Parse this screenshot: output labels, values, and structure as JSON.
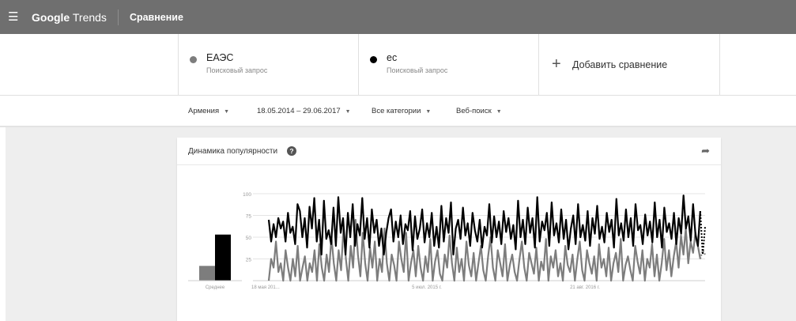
{
  "topbar": {
    "menu_icon": "menu-icon",
    "logo_google": "Google",
    "logo_trends": "Trends",
    "page_name": "Сравнение"
  },
  "terms": [
    {
      "name": "ЕАЭС",
      "type": "Поисковый запрос",
      "color": "#7d7d7d"
    },
    {
      "name": "ес",
      "type": "Поисковый запрос",
      "color": "#000000"
    }
  ],
  "add_compare": {
    "icon": "plus-icon",
    "label": "Добавить сравнение"
  },
  "filters": {
    "region": "Армения",
    "dates": "18.05.2014 – 29.06.2017",
    "category": "Все категории",
    "search_type": "Веб-поиск"
  },
  "card": {
    "title": "Динамика популярности",
    "help_icon": "help-icon",
    "share_icon": "share-icon"
  },
  "chart_data": {
    "type": "line",
    "y_ticks": [
      "100",
      "75",
      "50",
      "25"
    ],
    "ylim": [
      0,
      100
    ],
    "x_tick_labels": [
      "18 мая 201...",
      "5 июл. 2015 г.",
      "21 авг. 2016 г."
    ],
    "average_label": "Среднее",
    "averages": [
      {
        "term": "ЕАЭС",
        "value": 17,
        "color": "#7d7d7d"
      },
      {
        "term": "ес",
        "value": 53,
        "color": "#000000"
      }
    ],
    "series": [
      {
        "name": "ес",
        "color": "#000000",
        "values": [
          70,
          45,
          65,
          50,
          72,
          60,
          68,
          45,
          78,
          55,
          62,
          42,
          88,
          80,
          50,
          72,
          38,
          85,
          60,
          95,
          45,
          70,
          30,
          92,
          48,
          58,
          42,
          84,
          40,
          96,
          55,
          72,
          30,
          78,
          50,
          88,
          40,
          65,
          52,
          95,
          48,
          72,
          38,
          82,
          55,
          70,
          40,
          60,
          30,
          55,
          72,
          82,
          45,
          68,
          50,
          75,
          42,
          65,
          58,
          80,
          35,
          74,
          48,
          60,
          82,
          44,
          66,
          50,
          78,
          40,
          62,
          38,
          86,
          45,
          72,
          55,
          90,
          30,
          60,
          70,
          48,
          84,
          52,
          66,
          40,
          78,
          58,
          45,
          70,
          38,
          62,
          52,
          88,
          44,
          74,
          50,
          68,
          42,
          80,
          56,
          72,
          48,
          64,
          36,
          92,
          50,
          70,
          42,
          84,
          55,
          72,
          38,
          96,
          45,
          68,
          58,
          78,
          40,
          90,
          52,
          66,
          44,
          82,
          48,
          70,
          36,
          60,
          75,
          42,
          88,
          50,
          64,
          46,
          80,
          40,
          72,
          54,
          86,
          48,
          62,
          44,
          78,
          56,
          70,
          38,
          94,
          52,
          66,
          46,
          82,
          50,
          72,
          40,
          88,
          58,
          64,
          42,
          76,
          52,
          68,
          44,
          90,
          50,
          70,
          38,
          84,
          56,
          66,
          48,
          78,
          42,
          72,
          54,
          98,
          60,
          74,
          46,
          88,
          52,
          40,
          80,
          30,
          62
        ]
      },
      {
        "name": "ЕАЭС",
        "color": "#7d7d7d",
        "values": [
          0,
          25,
          15,
          45,
          10,
          20,
          0,
          35,
          15,
          0,
          25,
          5,
          40,
          0,
          15,
          28,
          0,
          20,
          10,
          35,
          0,
          42,
          15,
          0,
          30,
          10,
          50,
          20,
          0,
          35,
          12,
          60,
          25,
          0,
          40,
          15,
          70,
          30,
          5,
          55,
          20,
          0,
          38,
          15,
          45,
          0,
          25,
          10,
          60,
          20,
          0,
          30,
          18,
          0,
          45,
          25,
          10,
          55,
          0,
          20,
          35,
          5,
          40,
          15,
          0,
          28,
          10,
          48,
          0,
          22,
          35,
          8,
          0,
          30,
          15,
          52,
          20,
          0,
          38,
          10,
          25,
          0,
          45,
          18,
          5,
          32,
          0,
          20,
          40,
          12,
          0,
          28,
          50,
          15,
          0,
          35,
          20,
          5,
          42,
          0,
          18,
          30,
          10,
          0,
          25,
          45,
          15,
          0,
          32,
          20,
          8,
          38,
          0,
          22,
          12,
          48,
          0,
          28,
          15,
          35,
          5,
          20,
          0,
          40,
          18,
          10,
          30,
          0,
          25,
          45,
          12,
          0,
          35,
          20,
          8,
          28,
          0,
          42,
          15,
          25,
          5,
          38,
          0,
          20,
          32,
          10,
          48,
          0,
          18,
          28,
          12,
          0,
          40,
          22,
          8,
          35,
          0,
          25,
          15,
          42,
          5,
          30,
          0,
          20,
          48,
          12,
          35,
          5,
          28,
          45,
          15,
          52,
          30,
          60,
          20,
          45,
          32,
          55,
          40,
          25,
          35,
          30
        ]
      }
    ]
  }
}
